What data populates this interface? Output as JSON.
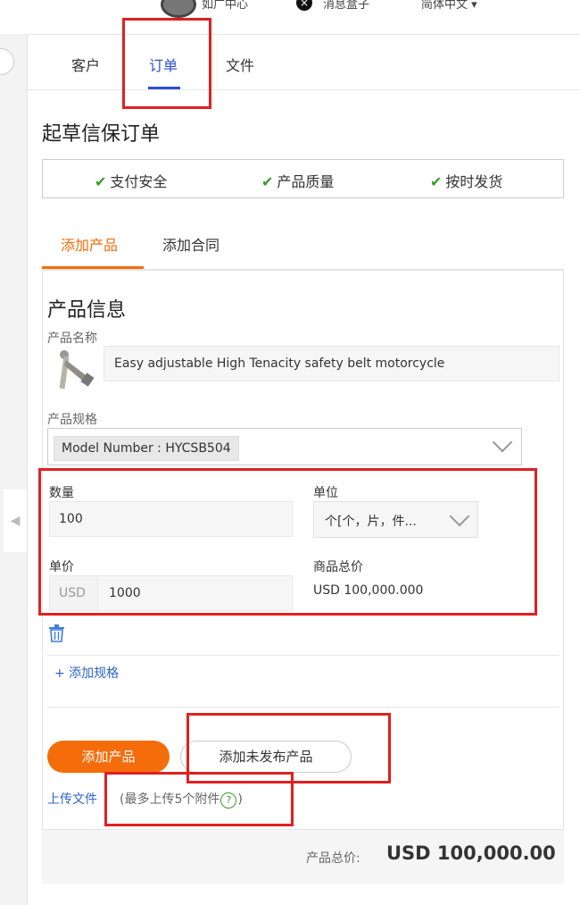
{
  "topbar": {
    "user": "如广中心",
    "close_glyph": "×",
    "messages": "消息盒子",
    "language": "简体中文 ▾"
  },
  "main_tabs": [
    "客户",
    "订单",
    "文件"
  ],
  "page_title": "起草信保订单",
  "assurances": [
    "支付安全",
    "产品质量",
    "按时发货"
  ],
  "sub_tabs": [
    "添加产品",
    "添加合同"
  ],
  "product_info": {
    "heading": "产品信息",
    "name_label": "产品名称",
    "name_value": "Easy adjustable  High Tenacity safety belt motorcycle",
    "spec_label": "产品规格",
    "spec_value": "Model Number : HYCSB504",
    "quantity_label": "数量",
    "quantity_value": "100",
    "unit_label": "单位",
    "unit_value": "个[个，片，件...",
    "price_label": "单价",
    "currency": "USD",
    "price_value": "1000",
    "total_label": "商品总价",
    "total_value": "USD 100,000.000",
    "add_spec": "+ 添加规格"
  },
  "buttons": {
    "add_product": "添加产品",
    "add_unpublished": "添加未发布产品"
  },
  "upload": {
    "link": "上传文件",
    "hint_prefix": "(最多上传5个附件",
    "hint_icon": "?",
    "hint_suffix": ")"
  },
  "footer": {
    "label": "产品总价:",
    "value": "USD 100,000.00"
  },
  "colors": {
    "accent_orange": "#f56d0b",
    "accent_blue": "#2d4fd2",
    "annotation_red": "#e02020",
    "check_green": "#3a9a2a"
  }
}
